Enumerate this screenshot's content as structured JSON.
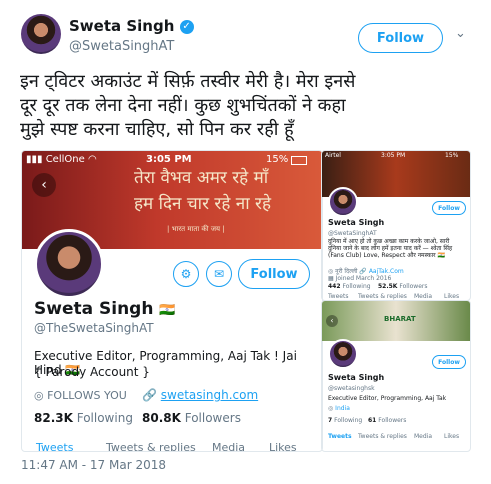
{
  "tweet": {
    "author_name": "Sweta Singh",
    "author_handle": "@SwetaSinghAT",
    "follow_label": "Follow",
    "text_line1": "इन ट्विटर अकाउंट में सिर्फ़ तस्वीर मेरी है। मेरा इनसे",
    "text_line2": "दूर दूर तक लेना देना नहीं। कुछ शुभचिंतकों ने कहा",
    "text_line3": "मुझे स्पष्ट करना चाहिए, सो पिन कर रही हूँ",
    "timestamp": "11:47 AM - 17 Mar 2018"
  },
  "shot1": {
    "carrier": "CellOne",
    "time": "3:05 PM",
    "battery": "15%",
    "banner_line1": "तेरा वैभव अमर रहे माँ",
    "banner_line2": "हम दिन चार रहे ना रहे",
    "banner_small": "| भारत माता की जय |",
    "follow_label": "Follow",
    "name": "Sweta Singh",
    "flag": "🇮🇳",
    "handle": "@TheSwetaSinghAT",
    "bio_line1": "Executive Editor, Programming, Aaj Tak ! Jai Hind 🇮🇳",
    "bio_line2": "{ Parody Account }",
    "follows_you": "FOLLOWS YOU",
    "website": "swetasingh.com",
    "following_count": "82.3K",
    "following_label": "Following",
    "followers_count": "80.8K",
    "followers_label": "Followers",
    "tabs": [
      "Tweets",
      "Tweets & replies",
      "Media",
      "Likes"
    ]
  },
  "shot2": {
    "carrier": "Airtel",
    "time": "3:05 PM",
    "battery": "15%",
    "follow_label": "Follow",
    "name": "Sweta Singh",
    "handle": "@SwetaSinghAT",
    "bio": "दुनिया में आए हो तो कुछ अच्छा काम करके जाओ, सारी दुनिया जाने के बाद लोग हमें इतना याद करें — श्वेता सिंह (Fans Club) Love, Respect और नमस्कार 🇮🇳",
    "location": "नूरी दिल्ली",
    "link": "AajTak.Com",
    "joined": "Joined March 2016",
    "following_count": "442",
    "following_label": "Following",
    "followers_count": "52.5K",
    "followers_label": "Followers",
    "tabs": [
      "Tweets",
      "Tweets & replies",
      "Media",
      "Likes"
    ]
  },
  "shot3": {
    "banner_text": "BHARAT",
    "follow_label": "Follow",
    "name": "Sweta Singh",
    "handle": "@swetasinghsk",
    "bio": "Executive Editor, Programming, Aaj Tak",
    "location": "India",
    "following_count": "7",
    "following_label": "Following",
    "followers_count": "61",
    "followers_label": "Followers",
    "tabs": [
      "Tweets",
      "Tweets & replies",
      "Media",
      "Likes"
    ]
  },
  "colors": {
    "twitter_blue": "#1da1f2",
    "banner_red": "#c0392b",
    "verified": "#1da1f2"
  }
}
